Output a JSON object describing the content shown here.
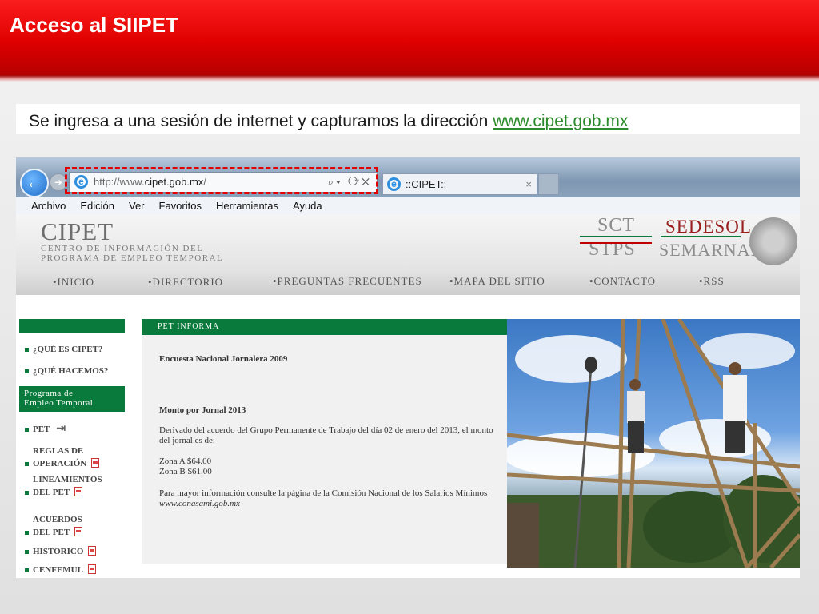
{
  "slide": {
    "title": "Acceso al SIIPET",
    "intro_text": "Se ingresa a una sesión de internet y capturamos la dirección",
    "intro_link": "www.cipet.gob.mx"
  },
  "browser": {
    "address_prefix": "http://www.",
    "address_domain": "cipet.gob.mx",
    "address_suffix": "/",
    "address_tools": "⌕▾ ⟳✕",
    "tab_title": "::CIPET::",
    "tab_close": "×",
    "back_glyph": "←",
    "ie_glyph": "e",
    "menu": [
      "Archivo",
      "Edición",
      "Ver",
      "Favoritos",
      "Herramientas",
      "Ayuda"
    ],
    "highlight_color": "#e00000"
  },
  "site": {
    "logo": "CIPET",
    "subtitle_1": "CENTRO DE INFORMACIÓN DEL",
    "subtitle_2": "PROGRAMA DE EMPLEO TEMPORAL",
    "agencies": {
      "sct": "SCT",
      "sedesol": "SEDESOL",
      "stps": "STPS",
      "semarnat": "SEMARNAT"
    },
    "nav": [
      "•INICIO",
      "•DIRECTORIO",
      "•PREGUNTAS FRECUENTES",
      "•MAPA DEL SITIO",
      "•CONTACTO",
      "•RSS"
    ],
    "sidebar": {
      "q1": "¿QUÉ ES CIPET?",
      "q2": "¿QUÉ HACEMOS?",
      "program_1": "Programa de",
      "program_2": "Empleo Temporal",
      "pet": "PET",
      "reglas_1": "REGLAS DE",
      "reglas_2": "OPERACIÓN",
      "lineamientos_1": "LINEAMIENTOS",
      "lineamientos_2": "DEL PET",
      "acuerdos_1": "ACUERDOS",
      "acuerdos_2": "DEL PET",
      "historico": "HISTORICO",
      "cenfemul": "CENFEMUL"
    },
    "main": {
      "section_title": "PET INFORMA",
      "item1_title": "Encuesta Nacional Jornalera 2009",
      "item2_title": "Monto por Jornal 2013",
      "item2_body": "Derivado del acuerdo del Grupo Permanente de Trabajo del día 02 de enero del 2013, el monto del jornal es de:",
      "zona_a": "Zona A $64.00",
      "zona_b": "Zona B $61.00",
      "more_info": "Para mayor información consulte la página de la Comisión Nacional de los Salarios Mínimos",
      "more_link": "www.conasami.gob.mx"
    },
    "green": "#0a7a3c"
  }
}
